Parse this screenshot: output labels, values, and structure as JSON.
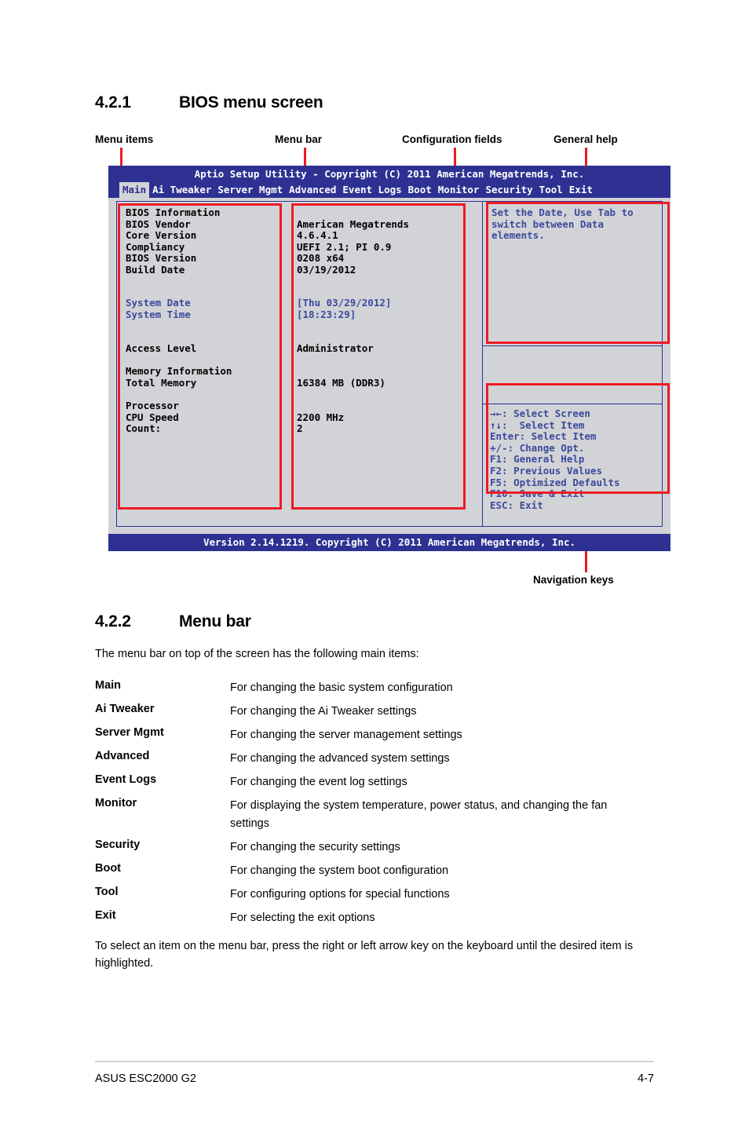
{
  "section_421": {
    "number": "4.2.1",
    "title": "BIOS menu screen"
  },
  "annotations": {
    "menu_items": "Menu items",
    "menu_bar": "Menu bar",
    "configuration_fields": "Configuration fields",
    "general_help": "General help",
    "navigation_keys": "Navigation keys"
  },
  "bios": {
    "title": "Aptio Setup Utility - Copyright (C) 2011 American Megatrends, Inc.",
    "tabs": [
      {
        "label": "Main",
        "active": true
      },
      {
        "label": "Ai Tweaker",
        "active": false
      },
      {
        "label": "Server Mgmt",
        "active": false
      },
      {
        "label": "Advanced",
        "active": false
      },
      {
        "label": "Event Logs",
        "active": false
      },
      {
        "label": "Boot",
        "active": false
      },
      {
        "label": "Monitor",
        "active": false
      },
      {
        "label": "Security",
        "active": false
      },
      {
        "label": "Tool",
        "active": false
      },
      {
        "label": "Exit",
        "active": false
      }
    ],
    "menu_items_text": "BIOS Information\nBIOS Vendor\nCore Version\nCompliancy\nBIOS Version\nBuild Date",
    "menu_items_date_text": "System Date\nSystem Time",
    "menu_items_tail_text": "Access Level\n\nMemory Information\nTotal Memory\n\nProcessor\nCPU Speed\nCount:",
    "values_text": "\nAmerican Megatrends\n4.6.4.1\nUEFI 2.1; PI 0.9\n0208 x64\n03/19/2012",
    "values_date_text": "[Thu 03/29/2012]\n[18:23:29]",
    "values_tail_text": "Administrator\n\n\n16384 MB (DDR3)\n\n\n2200 MHz\n2",
    "help_text": "Set the Date, Use Tab to switch between Data elements.",
    "nav_keys_text": "→←: Select Screen\n↑↓:  Select Item\nEnter: Select Item\n+/-: Change Opt.\nF1: General Help\nF2: Previous Values\nF5: Optimized Defaults\nF10: Save & Exit\nESC: Exit",
    "footer": "Version 2.14.1219. Copyright (C) 2011 American Megatrends, Inc.",
    "colors": {
      "bar_blue": "#2e3192",
      "panel_gray": "#d2d3d7",
      "text_blue": "#3b4a9c",
      "annotation_red": "#ee1b24"
    }
  },
  "section_422": {
    "number": "4.2.2",
    "title": "Menu bar",
    "intro": "The menu bar on top of the screen has the following main items:",
    "items": [
      {
        "term": "Main",
        "desc": "For changing the basic system configuration"
      },
      {
        "term": "Ai Tweaker",
        "desc": "For changing the Ai Tweaker settings"
      },
      {
        "term": "Server Mgmt",
        "desc": "For changing the server management settings"
      },
      {
        "term": "Advanced",
        "desc": "For changing the advanced system settings"
      },
      {
        "term": "Event Logs",
        "desc": "For changing the event log settings"
      },
      {
        "term": "Monitor",
        "desc": "For displaying the system temperature, power status, and changing the fan settings"
      },
      {
        "term": "Security",
        "desc": "For changing the security settings"
      },
      {
        "term": "Boot",
        "desc": "For changing the system boot configuration"
      },
      {
        "term": "Tool",
        "desc": "For configuring options for special functions"
      },
      {
        "term": "Exit",
        "desc": "For selecting the exit options"
      }
    ],
    "outro": "To select an item on the menu bar, press the right or left arrow key on the keyboard until the desired item is highlighted."
  },
  "page_footer": {
    "product": "ASUS ESC2000 G2",
    "page_number": "4-7"
  }
}
